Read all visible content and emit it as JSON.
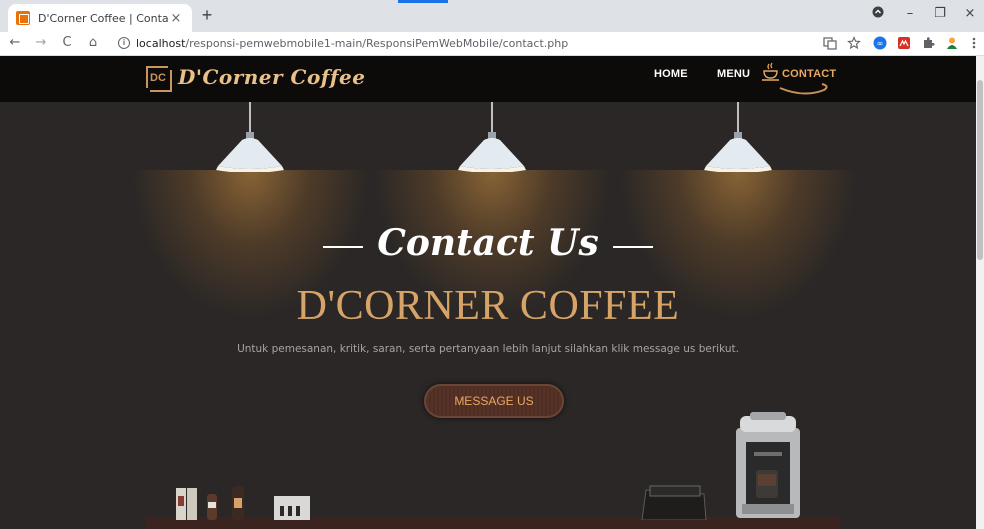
{
  "browser": {
    "tab_title": "D'Corner Coffee | Contact",
    "tab_close": "×",
    "new_tab": "+",
    "url_host": "localhost",
    "url_path": "/responsi-pemwebmobile1-main/ResponsiPemWebMobile/contact.php",
    "info_glyph": "i",
    "window_controls": [
      "–",
      "❐",
      "×"
    ],
    "nav": [
      "←",
      "→",
      "C",
      "⌂"
    ],
    "extensions": [
      "translate-icon",
      "star-icon",
      "ext-infinity-icon",
      "ext-red-icon",
      "puzzle-icon",
      "profile-icon",
      "menu-icon"
    ]
  },
  "site": {
    "logo_mark": "DC",
    "logo_text": "D'Corner Coffee",
    "menu": [
      {
        "label": "HOME",
        "active": false
      },
      {
        "label": "MENU",
        "active": false
      },
      {
        "label": "CONTACT",
        "active": true
      }
    ]
  },
  "hero": {
    "heading": "Contact Us",
    "brand": "D'CORNER COFFEE",
    "description": "Untuk pemesanan, kritik, saran, serta pertanyaan lebih lanjut silahkan klik message us berikut.",
    "button": "MESSAGE US"
  },
  "colors": {
    "accent": "#e8a862",
    "brand_gold": "#d7a468",
    "background": "#2a2726",
    "navbar": "#0d0b0a"
  }
}
